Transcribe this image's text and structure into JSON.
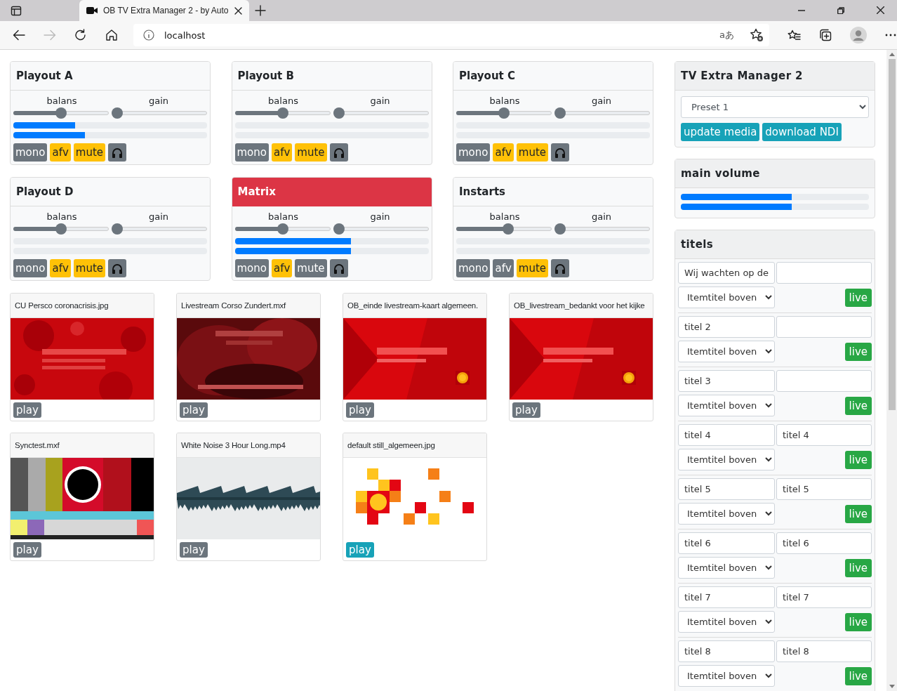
{
  "browser": {
    "tab_title": "OB TV Extra Manager 2 - by Auto",
    "address": "localhost",
    "translate_glyph": "aあ"
  },
  "channels": [
    {
      "name": "Playout A",
      "alert": false,
      "balans_label": "balans",
      "gain_label": "gain",
      "balans": {
        "level": 0.5
      },
      "gain": {
        "level": 0
      },
      "meters": [
        {
          "level": 0.32
        },
        {
          "level": 0.37
        }
      ],
      "buttons": [
        {
          "kind": "text",
          "label": "mono",
          "on": false
        },
        {
          "kind": "text",
          "label": "afv",
          "on": true
        },
        {
          "kind": "text",
          "label": "mute",
          "on": true
        },
        {
          "kind": "headphones",
          "on": false
        }
      ]
    },
    {
      "name": "Playout B",
      "alert": false,
      "balans_label": "balans",
      "gain_label": "gain",
      "balans": {
        "level": 0.5
      },
      "gain": {
        "level": 0
      },
      "meters": [
        {
          "level": 0
        },
        {
          "level": 0
        }
      ],
      "buttons": [
        {
          "kind": "text",
          "label": "mono",
          "on": false
        },
        {
          "kind": "text",
          "label": "afv",
          "on": true
        },
        {
          "kind": "text",
          "label": "mute",
          "on": true
        },
        {
          "kind": "headphones",
          "on": false
        }
      ]
    },
    {
      "name": "Playout C",
      "alert": false,
      "balans_label": "balans",
      "gain_label": "gain",
      "balans": {
        "level": 0.5
      },
      "gain": {
        "level": 0
      },
      "meters": [
        {
          "level": 0
        },
        {
          "level": 0
        }
      ],
      "buttons": [
        {
          "kind": "text",
          "label": "mono",
          "on": false
        },
        {
          "kind": "text",
          "label": "afv",
          "on": true
        },
        {
          "kind": "text",
          "label": "mute",
          "on": true
        },
        {
          "kind": "headphones",
          "on": false
        }
      ]
    },
    {
      "name": "Playout D",
      "alert": false,
      "balans_label": "balans",
      "gain_label": "gain",
      "balans": {
        "level": 0.5
      },
      "gain": {
        "level": 0
      },
      "meters": [
        {
          "level": 0
        },
        {
          "level": 0
        }
      ],
      "buttons": [
        {
          "kind": "text",
          "label": "mono",
          "on": false
        },
        {
          "kind": "text",
          "label": "afv",
          "on": true
        },
        {
          "kind": "text",
          "label": "mute",
          "on": true
        },
        {
          "kind": "headphones",
          "on": false
        }
      ]
    },
    {
      "name": "Matrix",
      "alert": true,
      "balans_label": "balans",
      "gain_label": "gain",
      "balans": {
        "level": 0.5
      },
      "gain": {
        "level": 0
      },
      "meters": [
        {
          "level": 0.6
        },
        {
          "level": 0.6
        }
      ],
      "buttons": [
        {
          "kind": "text",
          "label": "mono",
          "on": false
        },
        {
          "kind": "text",
          "label": "afv",
          "on": true
        },
        {
          "kind": "text",
          "label": "mute",
          "on": false
        },
        {
          "kind": "headphones",
          "on": false
        }
      ]
    },
    {
      "name": "Instarts",
      "alert": false,
      "balans_label": "balans",
      "gain_label": "gain",
      "balans": {
        "level": 0.55
      },
      "gain": {
        "level": 0
      },
      "meters": [
        {
          "level": 0
        },
        {
          "level": 0
        }
      ],
      "buttons": [
        {
          "kind": "text",
          "label": "mono",
          "on": false
        },
        {
          "kind": "text",
          "label": "afv",
          "on": false
        },
        {
          "kind": "text",
          "label": "mute",
          "on": true
        },
        {
          "kind": "headphones",
          "on": false
        }
      ]
    }
  ],
  "media": [
    {
      "title": "CU Persco coronacrisis.jpg",
      "play_label": "play",
      "selected": false
    },
    {
      "title": "Livestream Corso Zundert.mxf",
      "play_label": "play",
      "selected": false
    },
    {
      "title": "OB_einde livestream-kaart algemeen.",
      "play_label": "play",
      "selected": false
    },
    {
      "title": "OB_livestream_bedankt voor het kijke",
      "play_label": "play",
      "selected": false
    },
    {
      "title": "Synctest.mxf",
      "play_label": "play",
      "selected": false
    },
    {
      "title": "White Noise 3 Hour Long.mp4",
      "play_label": "play",
      "selected": false
    },
    {
      "title": "default still_algemeen.jpg",
      "play_label": "play",
      "selected": true
    }
  ],
  "manager": {
    "title": "TV Extra Manager 2",
    "preset": "Preset 1",
    "buttons": [
      "update media",
      "download NDI"
    ]
  },
  "main_volume": {
    "title": "main volume",
    "meters": [
      {
        "level": 0.59
      },
      {
        "level": 0.59
      }
    ]
  },
  "titels": {
    "title": "titels",
    "rows": [
      {
        "line_1": "Wij wachten op de",
        "line_2": "",
        "position": "Itemtitel boven",
        "live_label": "live"
      },
      {
        "line_1": "titel 2",
        "line_2": "",
        "position": "Itemtitel boven",
        "live_label": "live"
      },
      {
        "line_1": "titel 3",
        "line_2": "",
        "position": "Itemtitel boven",
        "live_label": "live"
      },
      {
        "line_1": "titel 4",
        "line_2": "titel 4",
        "position": "Itemtitel boven",
        "live_label": "live"
      },
      {
        "line_1": "titel 5",
        "line_2": "titel 5",
        "position": "Itemtitel boven",
        "live_label": "live"
      },
      {
        "line_1": "titel 6",
        "line_2": "titel 6",
        "position": "Itemtitel boven",
        "live_label": "live"
      },
      {
        "line_1": "titel 7",
        "line_2": "titel 7",
        "position": "Itemtitel boven",
        "live_label": "live"
      },
      {
        "line_1": "titel 8",
        "line_2": "titel 8",
        "position": "Itemtitel boven",
        "live_label": "live"
      }
    ]
  }
}
